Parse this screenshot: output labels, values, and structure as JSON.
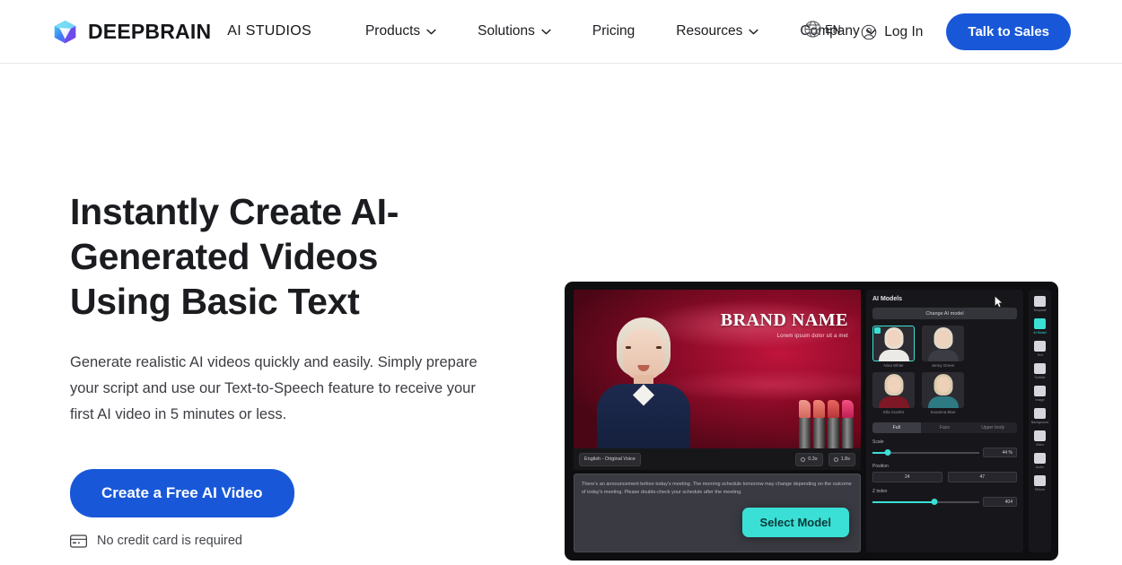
{
  "header": {
    "logo_icon": "cube-logo-icon",
    "brand_name": "DEEPBRAIN",
    "brand_sub": "AI STUDIOS",
    "nav": [
      {
        "label": "Products",
        "has_caret": true
      },
      {
        "label": "Solutions",
        "has_caret": true
      },
      {
        "label": "Pricing",
        "has_caret": false
      },
      {
        "label": "Resources",
        "has_caret": true
      },
      {
        "label": "Company",
        "has_caret": true
      }
    ],
    "language": {
      "icon": "globe-icon",
      "label": "EN"
    },
    "login": {
      "icon": "user-circle-icon",
      "label": "Log In"
    },
    "cta": "Talk to Sales"
  },
  "hero": {
    "title": "Instantly Create AI-Generated Videos Using Basic Text",
    "subtitle": "Generate realistic AI videos quickly and easily. Simply prepare your script and use our Text-to-Speech feature to receive your first AI video in 5 minutes or less.",
    "cta": "Create a Free AI Video",
    "note_icon": "credit-card-icon",
    "note": "No credit card is required"
  },
  "mockup": {
    "canvas": {
      "brand_title": "BRAND NAME",
      "brand_subtitle": "Lorem ipsum dolor sit a met"
    },
    "toolbar": {
      "voice_chip": "English - Original Voice",
      "duration_chip": "0.3s",
      "total_chip": "1.8s"
    },
    "script_text": "There's an announcement before today's meeting. The morning schedule tomorrow may change depending on the outcome of today's meeting. Please double-check your schedule after the meeting.",
    "select_model_button": "Select Model",
    "panel": {
      "title": "AI Models",
      "change_button": "Change AI model",
      "models": [
        {
          "name": "Nina White",
          "selected": true,
          "hair": "#e8dfd0",
          "skin": "#f0d4c0",
          "body": "#eceae6",
          "bg": "#2b2b31"
        },
        {
          "name": "Jenny Green",
          "selected": false,
          "hair": "#e3d8c6",
          "skin": "#efd2bd",
          "body": "#3c3c44",
          "bg": "#2b2b31"
        },
        {
          "name": "Ella Scarlet",
          "selected": false,
          "hair": "#dccdb4",
          "skin": "#f0d2bb",
          "body": "#7e1726",
          "bg": "#2b2b31"
        },
        {
          "name": "Susanna Blue",
          "selected": false,
          "hair": "#d9c9ad",
          "skin": "#eed0b9",
          "body": "#2e7a83",
          "bg": "#2b2b31"
        }
      ],
      "tabs": [
        {
          "label": "Full",
          "active": true
        },
        {
          "label": "Face",
          "active": false
        },
        {
          "label": "Upper body",
          "active": false
        }
      ],
      "controls": [
        {
          "label": "Scale",
          "type": "slider",
          "fill_pct": 14,
          "value": "44 %"
        },
        {
          "label": "Position",
          "type": "pair",
          "value_x": "24",
          "value_y": "47"
        },
        {
          "label": "Z index",
          "type": "slider",
          "fill_pct": 58,
          "value": "404"
        }
      ]
    },
    "rail": [
      {
        "icon": "template-icon",
        "label": "Template",
        "active": false
      },
      {
        "icon": "ai-model-icon",
        "label": "AI Model",
        "active": true
      },
      {
        "icon": "text-icon",
        "label": "Text",
        "active": false
      },
      {
        "icon": "subtitle-icon",
        "label": "Subtitle",
        "active": false
      },
      {
        "icon": "image-icon",
        "label": "Image",
        "active": false
      },
      {
        "icon": "background-icon",
        "label": "Background",
        "active": false
      },
      {
        "icon": "video-icon",
        "label": "Video",
        "active": false
      },
      {
        "icon": "audio-icon",
        "label": "Audio",
        "active": false
      },
      {
        "icon": "effects-icon",
        "label": "Effects",
        "active": false
      }
    ]
  },
  "colors": {
    "brand_blue": "#1858d8",
    "accent_cyan": "#3ae0d6",
    "text_dark": "#1b1c20"
  }
}
